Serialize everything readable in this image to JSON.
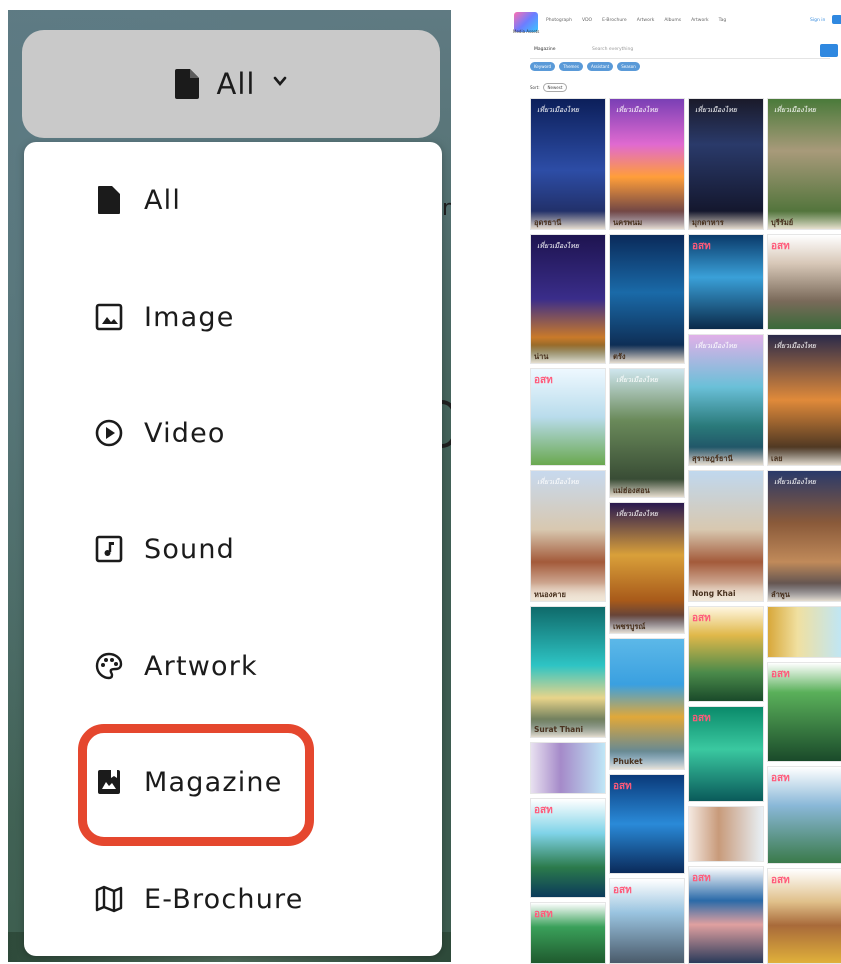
{
  "dropdown": {
    "selected_label": "All",
    "items": [
      {
        "label": "All",
        "icon": "file-icon"
      },
      {
        "label": "Image",
        "icon": "image-icon"
      },
      {
        "label": "Video",
        "icon": "play-circle-icon"
      },
      {
        "label": "Sound",
        "icon": "music-note-icon"
      },
      {
        "label": "Artwork",
        "icon": "palette-icon"
      },
      {
        "label": "Magazine",
        "icon": "magazine-icon"
      },
      {
        "label": "E-Brochure",
        "icon": "map-icon"
      }
    ],
    "highlighted_item": "Magazine",
    "highlight_color": "#e5472e"
  },
  "site": {
    "logo_text": "Media Assets",
    "nav": [
      "Photograph",
      "VDO",
      "E-Brochure",
      "Artwork",
      "Albums",
      "Artwork",
      "Tag"
    ],
    "sign_in": "Sign in",
    "search": {
      "type": "Magazine",
      "placeholder": "Search everything"
    },
    "chips": [
      "Keyword",
      "Themes",
      "Assistant",
      "Season"
    ],
    "sort_label": "Sort:",
    "sort_value": "Newest",
    "thumbnail_labels": [
      "อุดรธานี",
      "นครพนม",
      "มุกดาหาร",
      "บุรีรัมย์",
      "น่าน",
      "ตรัง",
      "แม่ฮ่องสอน",
      "สุราษฎร์ธานี",
      "เลย",
      "หนองคาย",
      "เพชรบูรณ์",
      "Nong Khai",
      "ลำพูน",
      "Surat Thani",
      "Phuket"
    ],
    "brand_mark": "อสท",
    "series_script": "เที่ยวเมืองไทย"
  }
}
